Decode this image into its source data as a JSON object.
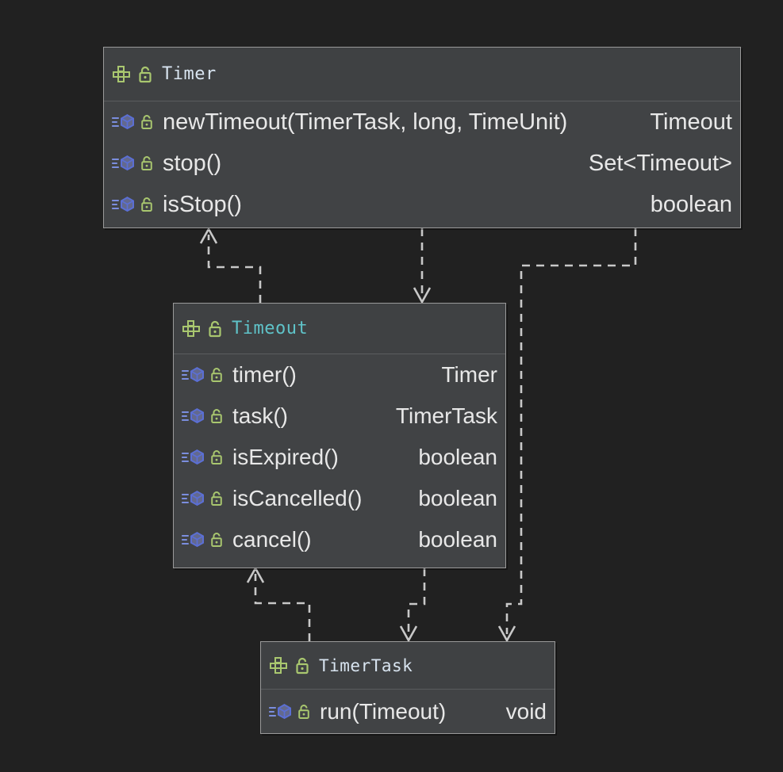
{
  "diagram": {
    "kind": "uml-class-diagram",
    "background_color": "#212121",
    "box_background": "#414345",
    "box_border_color": "#9a9a9a",
    "connector_color": "#c8c8c8",
    "icons": {
      "interface": "interface-icon",
      "method": "method-icon",
      "lock": "lock-open-icon"
    },
    "icon_colors": {
      "interface": "#a9c76f",
      "method": "#7b8ede",
      "lock": "#a9c76f"
    }
  },
  "boxes": [
    {
      "id": "timer",
      "title": "Timer",
      "title_color": "#d8e4f0",
      "members": [
        {
          "name": "newTimeout(TimerTask, long, TimeUnit)",
          "type": "Timeout"
        },
        {
          "name": "stop()",
          "type": "Set<Timeout>"
        },
        {
          "name": "isStop()",
          "type": "boolean"
        }
      ]
    },
    {
      "id": "timeout",
      "title": "Timeout",
      "title_color": "#5fc3c9",
      "members": [
        {
          "name": "timer()",
          "type": "Timer"
        },
        {
          "name": "task()",
          "type": "TimerTask"
        },
        {
          "name": "isExpired()",
          "type": "boolean"
        },
        {
          "name": "isCancelled()",
          "type": "boolean"
        },
        {
          "name": "cancel()",
          "type": "boolean"
        }
      ]
    },
    {
      "id": "timertask",
      "title": "TimerTask",
      "title_color": "#d8e4f0",
      "members": [
        {
          "name": "run(Timeout)",
          "type": "void"
        }
      ]
    }
  ],
  "connectors": [
    {
      "id": "timeout-to-timer",
      "from": "timeout",
      "to": "timer",
      "style": "dashed",
      "arrow": "open"
    },
    {
      "id": "timer-to-timeout",
      "from": "timer",
      "to": "timeout",
      "style": "dashed",
      "arrow": "open"
    },
    {
      "id": "timer-to-timertask",
      "from": "timer",
      "to": "timertask",
      "style": "dashed",
      "arrow": "open"
    },
    {
      "id": "timertask-to-timeout",
      "from": "timertask",
      "to": "timeout",
      "style": "dashed",
      "arrow": "open"
    },
    {
      "id": "timeout-to-timertask",
      "from": "timeout",
      "to": "timertask",
      "style": "dashed",
      "arrow": "open"
    }
  ]
}
